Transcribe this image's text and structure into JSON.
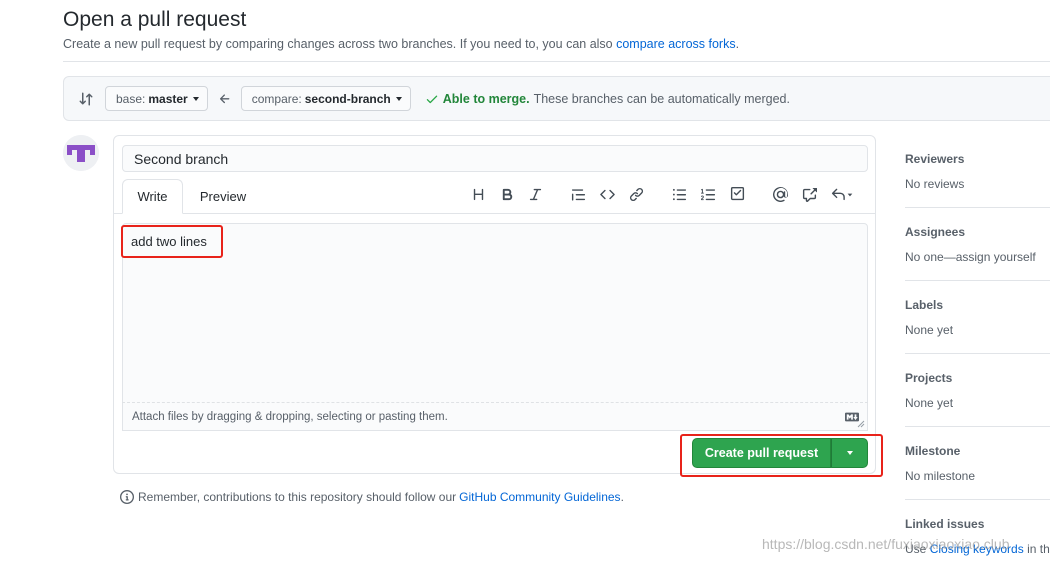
{
  "header": {
    "title": "Open a pull request",
    "subtitle_text": "Create a new pull request by comparing changes across two branches. If you need to, you can also ",
    "subtitle_link": "compare across forks",
    "subtitle_end": "."
  },
  "compare": {
    "base_prefix": "base:",
    "base_branch": "master",
    "compare_prefix": "compare:",
    "compare_branch": "second-branch",
    "merge_status": "Able to merge.",
    "merge_message": "These branches can be automatically merged."
  },
  "form": {
    "title_value": "Second branch",
    "tabs": [
      "Write",
      "Preview"
    ],
    "toolbar_icons": [
      "heading-icon",
      "bold-icon",
      "italic-icon",
      "quote-icon",
      "code-icon",
      "link-icon",
      "unordered-list-icon",
      "ordered-list-icon",
      "task-list-icon",
      "mention-icon",
      "cross-reference-icon",
      "reply-icon"
    ],
    "body_value": "add two lines",
    "attach_hint": "Attach files by dragging & dropping, selecting or pasting them.",
    "submit_label": "Create pull request"
  },
  "reminder": {
    "text": "Remember, contributions to this repository should follow our",
    "link": "GitHub Community Guidelines",
    "end": "."
  },
  "sidebar": [
    {
      "title": "Reviewers",
      "value": "No reviews"
    },
    {
      "title": "Assignees",
      "value": "No one—assign yourself"
    },
    {
      "title": "Labels",
      "value": "None yet"
    },
    {
      "title": "Projects",
      "value": "None yet"
    },
    {
      "title": "Milestone",
      "value": "No milestone"
    },
    {
      "title": "Linked issues",
      "value_prefix": "Use",
      "value_link": "Closing keywords",
      "value_suffix": "in th"
    }
  ],
  "watermark": "https://blog.csdn.net/fuxiaoxiaoxiao.club",
  "colors": {
    "accent_link": "#0366d6",
    "primary_button": "#2ea44f",
    "merge_ok": "#22863a",
    "highlight_annotation": "#e8231a"
  }
}
